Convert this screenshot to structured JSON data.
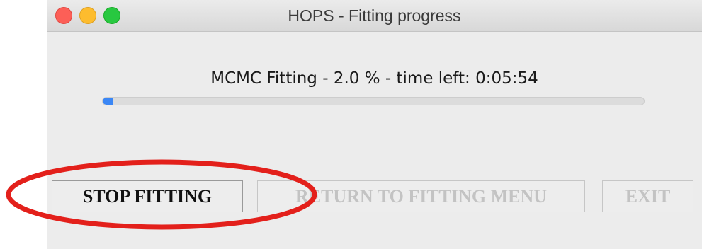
{
  "window": {
    "title": "HOPS - Fitting progress"
  },
  "progress": {
    "status_text": "MCMC Fitting - 2.0 % - time left: 0:05:54",
    "percent": 2.0,
    "fill_color": "#3b87f5"
  },
  "buttons": {
    "stop_label": "STOP FITTING",
    "return_label": "RETURN TO FITTING MENU",
    "exit_label": "EXIT"
  },
  "colors": {
    "annotation": "#e3201b",
    "traffic_close": "#fc5f57",
    "traffic_minimize": "#fdbc2e",
    "traffic_zoom": "#28c840"
  }
}
